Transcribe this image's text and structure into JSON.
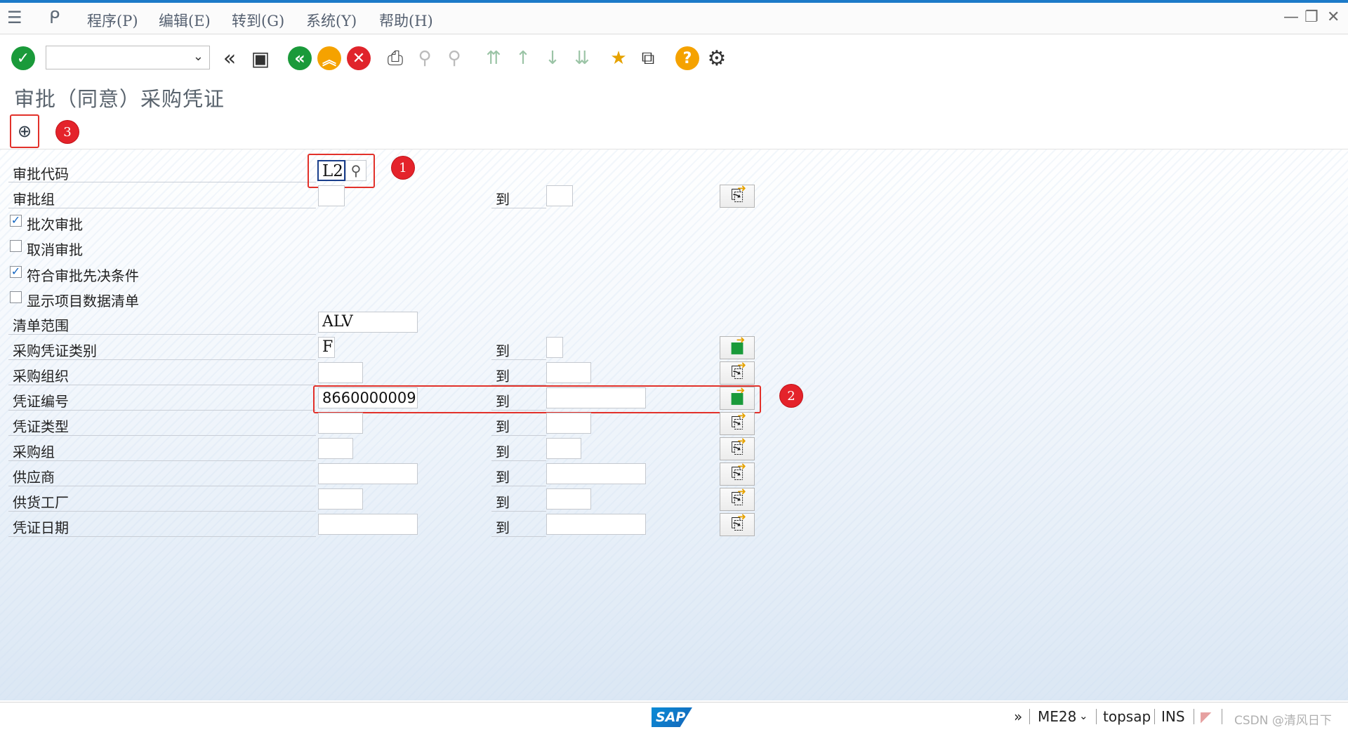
{
  "menubar": {
    "items": [
      "程序(P)",
      "编辑(E)",
      "转到(G)",
      "系统(Y)",
      "帮助(H)"
    ]
  },
  "title": "审批（同意）采购凭证",
  "badges": {
    "one": "1",
    "two": "2",
    "three": "3"
  },
  "form": {
    "to_label": "到",
    "release_code": {
      "label": "审批代码",
      "value": "L2"
    },
    "release_group": {
      "label": "审批组"
    },
    "checkboxes": [
      {
        "label": "批次审批",
        "checked": true
      },
      {
        "label": "取消审批",
        "checked": false
      },
      {
        "label": "符合审批先决条件",
        "checked": true
      },
      {
        "label": "显示项目数据清单",
        "checked": false
      }
    ],
    "list_scope": {
      "label": "清单范围",
      "value": "ALV"
    },
    "doc_category": {
      "label": "采购凭证类别",
      "value": "F"
    },
    "purch_org": {
      "label": "采购组织"
    },
    "doc_number": {
      "label": "凭证编号",
      "value": "8660000009"
    },
    "doc_type": {
      "label": "凭证类型"
    },
    "purch_group": {
      "label": "采购组"
    },
    "vendor": {
      "label": "供应商"
    },
    "plant": {
      "label": "供货工厂"
    },
    "doc_date": {
      "label": "凭证日期"
    }
  },
  "statusbar": {
    "expand": "»",
    "transaction": "ME28",
    "system": "topsap",
    "mode": "INS",
    "watermark": "CSDN @清风日下"
  },
  "icons": {
    "enter": "check-circle-icon",
    "back": "back-green-icon",
    "exit": "exit-orange-icon",
    "cancel": "cancel-red-icon",
    "help": "help-icon",
    "settings": "gear-icon"
  },
  "colors": {
    "highlight": "#e2312a",
    "accent_green": "#1a9a3a",
    "accent_orange": "#f5a200",
    "accent_red": "#e0242b",
    "topline": "#1c7ac8"
  }
}
